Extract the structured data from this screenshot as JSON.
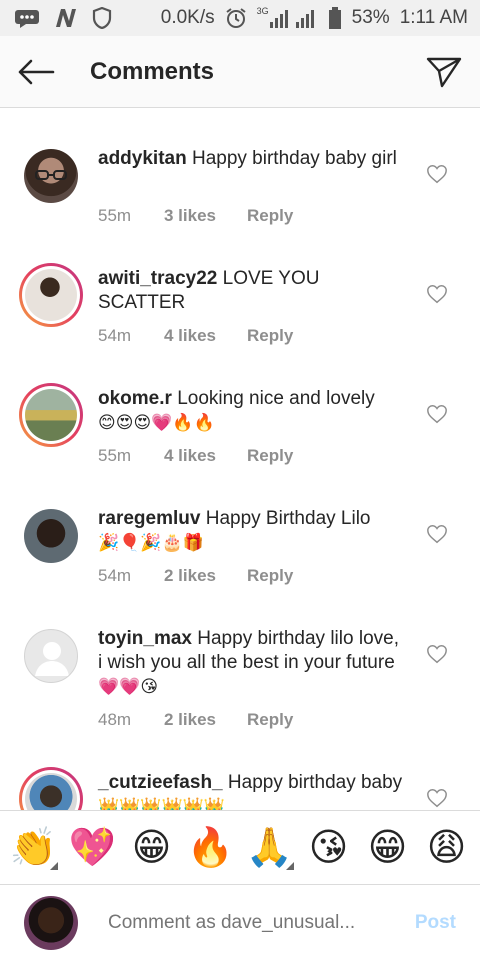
{
  "status_bar": {
    "speed": "0.0K/s",
    "network": "3G",
    "battery": "53%",
    "time": "1:11 AM"
  },
  "header": {
    "title": "Comments"
  },
  "comments": [
    {
      "username": "addykitan",
      "text": "Happy birthday baby girl",
      "emoji": "",
      "time": "55m",
      "likes": "3 likes",
      "reply": "Reply"
    },
    {
      "username": "awiti_tracy22",
      "text": "LOVE YOU SCATTER",
      "emoji": "",
      "time": "54m",
      "likes": "4 likes",
      "reply": "Reply"
    },
    {
      "username": "okome.r",
      "text": "Looking nice and lovely",
      "emoji": "😊😍😍💗🔥🔥",
      "time": "55m",
      "likes": "4 likes",
      "reply": "Reply"
    },
    {
      "username": "raregemluv",
      "text": "Happy Birthday Lilo",
      "emoji": "🎉🎈🎉🎂🎁",
      "time": "54m",
      "likes": "2 likes",
      "reply": "Reply"
    },
    {
      "username": "toyin_max",
      "text": "Happy birthday lilo love, i wish you all the best in your future",
      "emoji": "💗💗😘",
      "time": "48m",
      "likes": "2 likes",
      "reply": "Reply"
    },
    {
      "username": "_cutzieefash_",
      "text": "Happy birthday baby",
      "emoji": "👑👑👑👑👑👑",
      "time": "",
      "likes": "",
      "reply": ""
    }
  ],
  "quick_emojis": [
    "👏",
    "💖",
    "😁",
    "🔥",
    "🙏",
    "😘",
    "😁",
    "😩"
  ],
  "composer": {
    "placeholder": "Comment as dave_unusual...",
    "post_label": "Post"
  }
}
